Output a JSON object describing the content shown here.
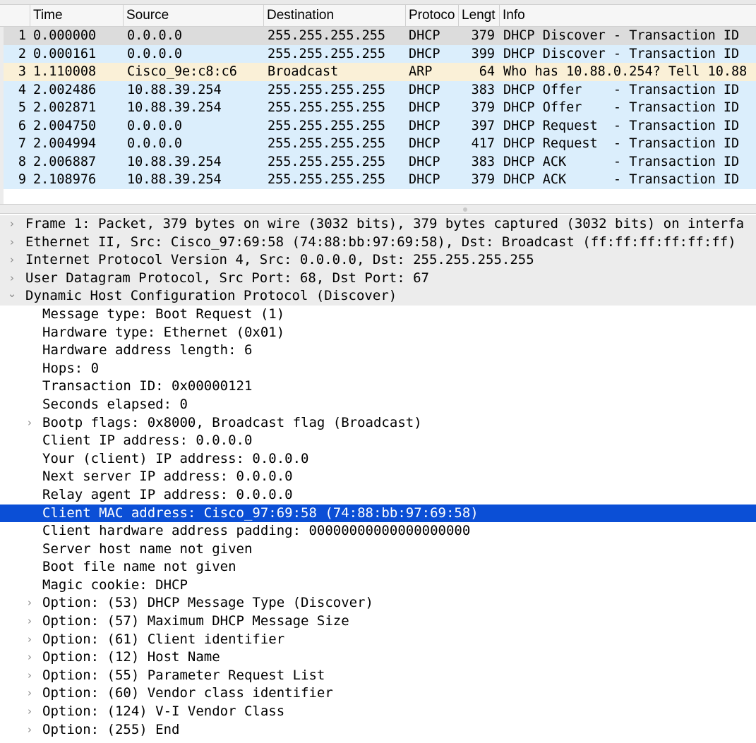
{
  "packet_list": {
    "columns": [
      "",
      "Time",
      "Source",
      "Destination",
      "Protoco",
      "Lengt",
      "Info"
    ],
    "rows": [
      {
        "no": "1",
        "time": "0.000000",
        "source": "0.0.0.0",
        "destination": "255.255.255.255",
        "protocol": "DHCP",
        "length": "379",
        "info": "DHCP Discover - Transaction ID",
        "kind": "sel"
      },
      {
        "no": "2",
        "time": "0.000161",
        "source": "0.0.0.0",
        "destination": "255.255.255.255",
        "protocol": "DHCP",
        "length": "399",
        "info": "DHCP Discover - Transaction ID",
        "kind": "dhcp"
      },
      {
        "no": "3",
        "time": "1.110008",
        "source": "Cisco_9e:c8:c6",
        "destination": "Broadcast",
        "protocol": "ARP",
        "length": "64",
        "info": "Who has 10.88.0.254? Tell 10.88",
        "kind": "arp"
      },
      {
        "no": "4",
        "time": "2.002486",
        "source": "10.88.39.254",
        "destination": "255.255.255.255",
        "protocol": "DHCP",
        "length": "383",
        "info": "DHCP Offer    - Transaction ID",
        "kind": "dhcp"
      },
      {
        "no": "5",
        "time": "2.002871",
        "source": "10.88.39.254",
        "destination": "255.255.255.255",
        "protocol": "DHCP",
        "length": "379",
        "info": "DHCP Offer    - Transaction ID",
        "kind": "dhcp"
      },
      {
        "no": "6",
        "time": "2.004750",
        "source": "0.0.0.0",
        "destination": "255.255.255.255",
        "protocol": "DHCP",
        "length": "397",
        "info": "DHCP Request  - Transaction ID",
        "kind": "dhcp"
      },
      {
        "no": "7",
        "time": "2.004994",
        "source": "0.0.0.0",
        "destination": "255.255.255.255",
        "protocol": "DHCP",
        "length": "417",
        "info": "DHCP Request  - Transaction ID",
        "kind": "dhcp"
      },
      {
        "no": "8",
        "time": "2.006887",
        "source": "10.88.39.254",
        "destination": "255.255.255.255",
        "protocol": "DHCP",
        "length": "383",
        "info": "DHCP ACK      - Transaction ID",
        "kind": "dhcp"
      },
      {
        "no": "9",
        "time": "2.108976",
        "source": "10.88.39.254",
        "destination": "255.255.255.255",
        "protocol": "DHCP",
        "length": "379",
        "info": "DHCP ACK      - Transaction ID",
        "kind": "dhcp"
      }
    ]
  },
  "details": {
    "items": [
      {
        "text": "Frame 1: Packet, 379 bytes on wire (3032 bits), 379 bytes captured (3032 bits) on interfa",
        "level": "top",
        "arrow": "collapsed"
      },
      {
        "text": "Ethernet II, Src: Cisco_97:69:58 (74:88:bb:97:69:58), Dst: Broadcast (ff:ff:ff:ff:ff:ff)",
        "level": "top",
        "arrow": "collapsed"
      },
      {
        "text": "Internet Protocol Version 4, Src: 0.0.0.0, Dst: 255.255.255.255",
        "level": "top",
        "arrow": "collapsed"
      },
      {
        "text": "User Datagram Protocol, Src Port: 68, Dst Port: 67",
        "level": "top",
        "arrow": "collapsed"
      },
      {
        "text": "Dynamic Host Configuration Protocol (Discover)",
        "level": "top",
        "arrow": "expanded"
      },
      {
        "text": "Message type: Boot Request (1)",
        "level": "child",
        "arrow": "none"
      },
      {
        "text": "Hardware type: Ethernet (0x01)",
        "level": "child",
        "arrow": "none"
      },
      {
        "text": "Hardware address length: 6",
        "level": "child",
        "arrow": "none"
      },
      {
        "text": "Hops: 0",
        "level": "child",
        "arrow": "none"
      },
      {
        "text": "Transaction ID: 0x00000121",
        "level": "child",
        "arrow": "none"
      },
      {
        "text": "Seconds elapsed: 0",
        "level": "child",
        "arrow": "none"
      },
      {
        "text": "Bootp flags: 0x8000, Broadcast flag (Broadcast)",
        "level": "child",
        "arrow": "collapsed"
      },
      {
        "text": "Client IP address: 0.0.0.0",
        "level": "child",
        "arrow": "none"
      },
      {
        "text": "Your (client) IP address: 0.0.0.0",
        "level": "child",
        "arrow": "none"
      },
      {
        "text": "Next server IP address: 0.0.0.0",
        "level": "child",
        "arrow": "none"
      },
      {
        "text": "Relay agent IP address: 0.0.0.0",
        "level": "child",
        "arrow": "none"
      },
      {
        "text": "Client MAC address: Cisco_97:69:58 (74:88:bb:97:69:58)",
        "level": "child",
        "arrow": "none",
        "selected": true
      },
      {
        "text": "Client hardware address padding: 00000000000000000000",
        "level": "child",
        "arrow": "none"
      },
      {
        "text": "Server host name not given",
        "level": "child",
        "arrow": "none"
      },
      {
        "text": "Boot file name not given",
        "level": "child",
        "arrow": "none"
      },
      {
        "text": "Magic cookie: DHCP",
        "level": "child",
        "arrow": "none"
      },
      {
        "text": "Option: (53) DHCP Message Type (Discover)",
        "level": "child",
        "arrow": "collapsed"
      },
      {
        "text": "Option: (57) Maximum DHCP Message Size",
        "level": "child",
        "arrow": "collapsed"
      },
      {
        "text": "Option: (61) Client identifier",
        "level": "child",
        "arrow": "collapsed"
      },
      {
        "text": "Option: (12) Host Name",
        "level": "child",
        "arrow": "collapsed"
      },
      {
        "text": "Option: (55) Parameter Request List",
        "level": "child",
        "arrow": "collapsed"
      },
      {
        "text": "Option: (60) Vendor class identifier",
        "level": "child",
        "arrow": "collapsed"
      },
      {
        "text": "Option: (124) V-I Vendor Class",
        "level": "child",
        "arrow": "collapsed"
      },
      {
        "text": "Option: (255) End",
        "level": "child",
        "arrow": "collapsed"
      }
    ]
  },
  "colors": {
    "selected_row": "#dcdcdc",
    "dhcp_row": "#dbeefc",
    "arp_row": "#faf0d7",
    "tree_selection": "#0b4fd6",
    "tree_top_row": "#ececec"
  },
  "icons": {
    "collapsed": "chevron-right-icon",
    "expanded": "chevron-down-icon"
  }
}
